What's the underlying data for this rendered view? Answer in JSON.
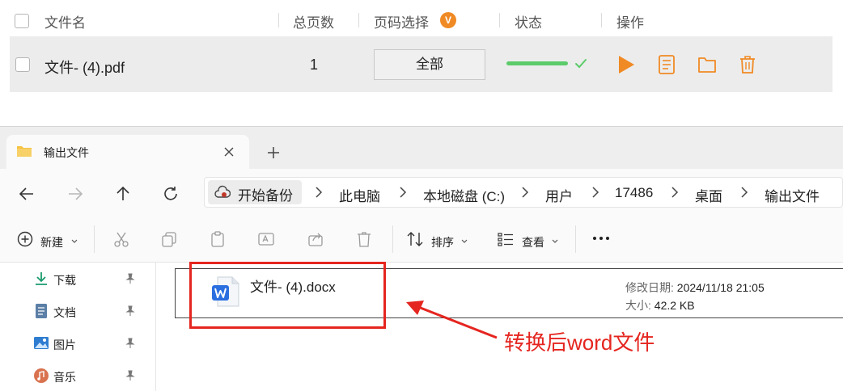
{
  "converter": {
    "header": {
      "filename": "文件名",
      "total_pages": "总页数",
      "page_select": "页码选择",
      "page_select_badge": "V",
      "status": "状态",
      "actions": "操作"
    },
    "rows": [
      {
        "filename": "文件- (4).pdf",
        "total_pages": "1",
        "page_select": "全部",
        "progress": 1.0,
        "status": "done"
      }
    ],
    "colors": {
      "accent": "#f08a24",
      "success": "#5ccb6a",
      "row_bg": "#ececec"
    }
  },
  "explorer": {
    "tab_title": "输出文件",
    "breadcrumb": [
      "开始备份",
      "此电脑",
      "本地磁盘 (C:)",
      "用户",
      "17486",
      "桌面",
      "输出文件"
    ],
    "toolbar": {
      "new": "新建",
      "sort": "排序",
      "view": "查看"
    },
    "sidebar": [
      {
        "label": "下载",
        "icon": "download-icon"
      },
      {
        "label": "文档",
        "icon": "document-icon"
      },
      {
        "label": "图片",
        "icon": "image-icon"
      },
      {
        "label": "音乐",
        "icon": "music-icon"
      }
    ],
    "file": {
      "name": "文件- (4).docx",
      "modified_label": "修改日期:",
      "modified_value": "2024/11/18 21:05",
      "size_label": "大小:",
      "size_value": "42.2 KB"
    }
  },
  "annotation": {
    "text": "转换后word文件",
    "color": "#e5251f"
  }
}
